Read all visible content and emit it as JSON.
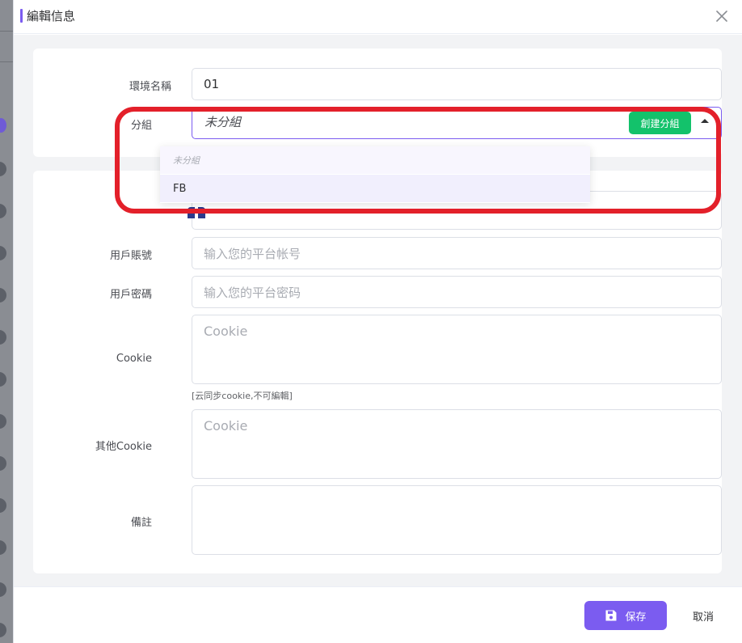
{
  "modal": {
    "title": "編輯信息",
    "close_icon": "close-icon"
  },
  "form": {
    "env_name": {
      "label": "環境名稱",
      "value": "01"
    },
    "group": {
      "label": "分組",
      "selected": "未分組",
      "create_button": "創建分組",
      "options": [
        "未分組",
        "FB"
      ]
    },
    "platform": {
      "icon": "facebook-icon"
    },
    "account": {
      "label": "用戶賬號",
      "placeholder": "输入您的平台帐号"
    },
    "password": {
      "label": "用戶密碼",
      "placeholder": "输入您的平台密码"
    },
    "cookie": {
      "label": "Cookie",
      "placeholder": "Cookie",
      "hint": "[云同步cookie,不可編輯]"
    },
    "other_cookie": {
      "label": "其他Cookie",
      "placeholder": "Cookie"
    },
    "remark": {
      "label": "備註",
      "placeholder": ""
    }
  },
  "footer": {
    "save_label": "保存",
    "cancel_label": "取消"
  },
  "colors": {
    "accent": "#7b5cf0",
    "create_green": "#13c26b",
    "highlight_red": "#e3202a"
  }
}
